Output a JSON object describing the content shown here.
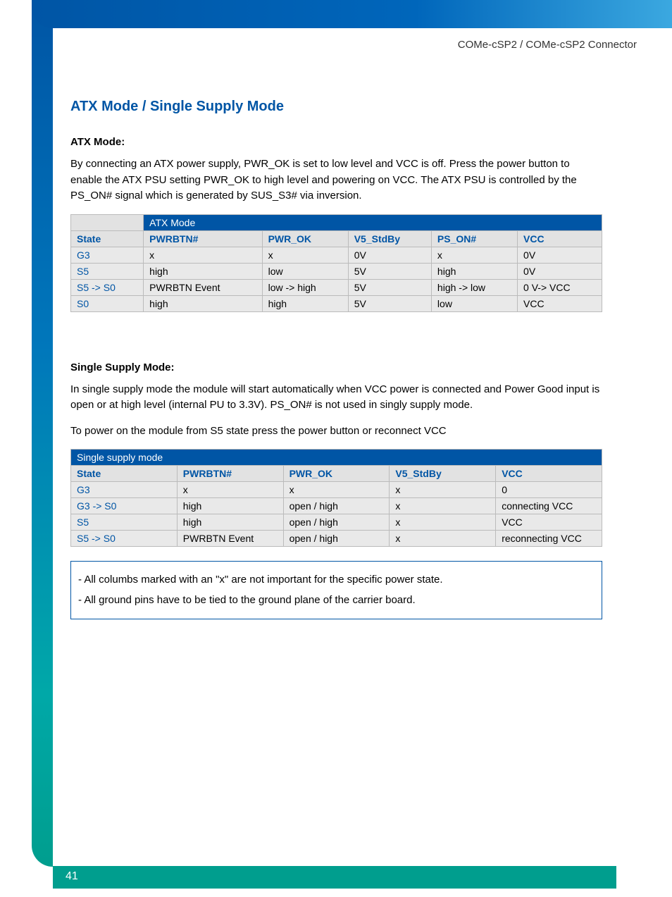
{
  "header": {
    "path": "COMe-cSP2 / COMe-cSP2 Connector"
  },
  "section": {
    "title": "ATX Mode / Single Supply Mode"
  },
  "atx": {
    "heading": "ATX Mode:",
    "paragraph": "By connecting an ATX power supply, PWR_OK is set to low level and VCC is off. Press the power button to enable the ATX PSU setting PWR_OK to high level and powering on VCC. The ATX PSU is controlled by the PS_ON# signal which is generated by SUS_S3# via inversion.",
    "table_title": "ATX Mode",
    "columns": [
      "State",
      "PWRBTN#",
      "PWR_OK",
      "V5_StdBy",
      "PS_ON#",
      "VCC"
    ],
    "rows": [
      [
        "G3",
        "x",
        "x",
        "0V",
        "x",
        "0V"
      ],
      [
        "S5",
        "high",
        "low",
        "5V",
        "high",
        "0V"
      ],
      [
        "S5 -> S0",
        "PWRBTN Event",
        "low -> high",
        "5V",
        "high -> low",
        "0 V-> VCC"
      ],
      [
        "S0",
        "high",
        "high",
        "5V",
        "low",
        "VCC"
      ]
    ]
  },
  "single": {
    "heading": "Single Supply Mode:",
    "paragraph1": "In single supply mode the module will start automatically when VCC power is connected and Power Good input is open or at high level (internal PU to 3.3V). PS_ON# is not used in singly supply mode.",
    "paragraph2": "To power on the module from S5 state press the power button or reconnect VCC",
    "table_title": "Single supply mode",
    "columns": [
      "State",
      "PWRBTN#",
      "PWR_OK",
      "V5_StdBy",
      "VCC"
    ],
    "rows": [
      [
        "G3",
        "x",
        "x",
        "x",
        "0"
      ],
      [
        "G3 -> S0",
        "high",
        "open / high",
        "x",
        "connecting VCC"
      ],
      [
        "S5",
        "high",
        "open / high",
        "x",
        "VCC"
      ],
      [
        "S5 -> S0",
        "PWRBTN Event",
        "open / high",
        "x",
        "reconnecting VCC"
      ]
    ]
  },
  "notes": {
    "line1": "- All columbs marked with an \"x\" are not important for the specific power state.",
    "line2": "- All ground pins have to be tied to the ground plane of the carrier board."
  },
  "page_number": "41"
}
